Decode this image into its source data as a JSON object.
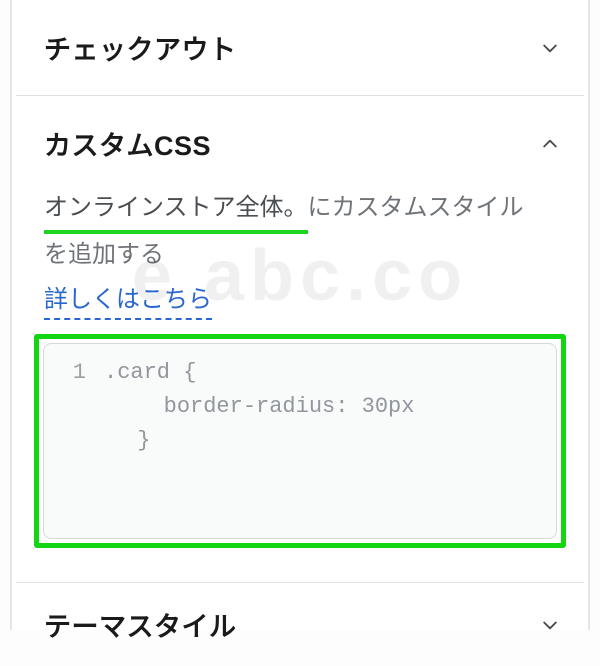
{
  "sections": {
    "checkout": {
      "title": "チェックアウト"
    },
    "custom_css": {
      "title": "カスタムCSS"
    },
    "theme_style": {
      "title": "テーマスタイル"
    }
  },
  "custom_css": {
    "desc_underlined": "オンラインストア全体。",
    "desc_rest_1": "にカスタムスタイル",
    "desc_rest_2": "を追加する",
    "learn_more": "詳しくはこちら",
    "code_line_no": "1",
    "code": ".card {\n        border-radius: 30px\n      }"
  },
  "watermark": "e    abc.co"
}
